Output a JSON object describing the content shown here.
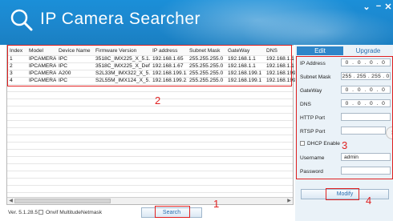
{
  "app": {
    "title": "IP Camera Searcher",
    "minimize_glyph": "−",
    "close_glyph": "✕",
    "menu_glyph": "⌄"
  },
  "table": {
    "columns": [
      "Index",
      "Model",
      "Device Name",
      "Firmware Version",
      "IP address",
      "Subnet Mask",
      "GateWay",
      "DNS"
    ],
    "rows": [
      [
        "1",
        "IPCAMERA",
        "IPC",
        "3518C_IMX225_X_5.1...",
        "192.168.1.65",
        "255.255.255.0",
        "192.168.1.1",
        "192.168.1.1"
      ],
      [
        "2",
        "IPCAMERA",
        "IPC",
        "3518C_IMX225_X_Defa...",
        "192.168.1.67",
        "255.255.255.0",
        "192.168.1.1",
        "192.168.1.1"
      ],
      [
        "3",
        "IPCAMERA",
        "A200",
        "S2L33M_IMX322_X_5...",
        "192.168.199.1...",
        "255.255.255.0",
        "192.168.199.1",
        "192.168.199"
      ],
      [
        "4",
        "IPCAMERA",
        "IPC",
        "S2L55M_IMX124_X_5...",
        "192.168.199.2...",
        "255.255.255.0",
        "192.168.199.1",
        "192.168.199"
      ]
    ]
  },
  "side": {
    "tabs": [
      "Edit",
      "Upgrade"
    ],
    "labels": {
      "ip": "IP Address",
      "subnet": "Subnet Mask",
      "gateway": "GateWay",
      "dns": "DNS",
      "http": "HTTP Port",
      "rtsp": "RTSP Port",
      "dhcp": "DHCP Enable",
      "username": "Username",
      "password": "Password"
    },
    "values": {
      "ip": "0 . 0 . 0 . 0",
      "subnet": "255 . 255 . 255 . 0",
      "gateway": "0 . 0 . 0 . 0",
      "dns": "0 . 0 . 0 . 0",
      "http": "",
      "rtsp": "",
      "username": "admin",
      "password": ""
    },
    "modify_label": "Modify"
  },
  "footer": {
    "version": "Ver. 5.1.28.5",
    "onvif_label": "Onvif MultitudeNetmask",
    "search_label": "Search"
  },
  "annotations": [
    "1",
    "2",
    "3",
    "4"
  ],
  "colors": {
    "header_blue": "#1b8fd8",
    "tab_active": "#2e86c9",
    "annotation_red": "#e02020"
  }
}
